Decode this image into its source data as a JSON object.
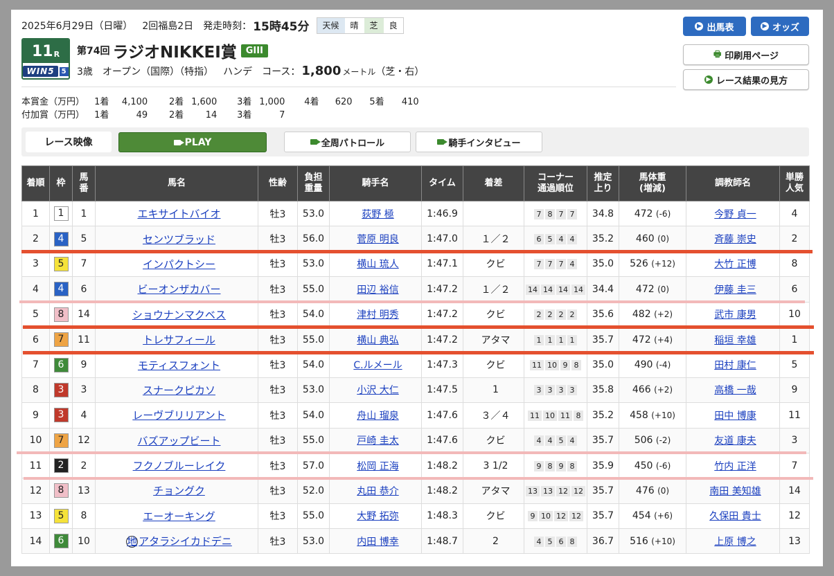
{
  "header": {
    "date": "2025年6月29日（日曜）",
    "meeting": "2回福島2日",
    "start_label": "発走時刻：",
    "start_time": "15時45分",
    "weather_label": "天候",
    "weather": "晴",
    "track_label": "芝",
    "track_cond": "良"
  },
  "race": {
    "number": "11",
    "number_suffix": "R",
    "win5_text": "WIN5",
    "win5_num": "5",
    "edition": "第74回",
    "name": "ラジオNIKKEI賞",
    "grade": "GIII",
    "cond1": "3歳",
    "cond2": "オープン（国際）（特指）",
    "cond3": "ハンデ",
    "course_label": "コース：",
    "distance": "1,800",
    "unit": "メートル",
    "surface": "（芝・右）"
  },
  "prize": {
    "main_label": "本賞金（万円）",
    "add_label": "付加賞（万円）",
    "places": [
      "1着",
      "2着",
      "3着",
      "4着",
      "5着"
    ],
    "main_values": [
      "4,100",
      "1,600",
      "1,000",
      "620",
      "410"
    ],
    "add_values": [
      "49",
      "14",
      "7"
    ]
  },
  "buttons": {
    "entries": "出馬表",
    "odds": "オッズ",
    "print": "印刷用ページ",
    "howto": "レース結果の見方"
  },
  "video": {
    "label": "レース映像",
    "play": "PLAY",
    "patrol": "全周パトロール",
    "interview": "騎手インタビュー"
  },
  "table": {
    "headers": [
      "着順",
      "枠",
      "馬番",
      "馬名",
      "性齢",
      "負担重量",
      "騎手名",
      "タイム",
      "着差",
      "コーナー通過順位",
      "推定上り",
      "馬体重(増減)",
      "調教師名",
      "単勝人気"
    ],
    "rows": [
      {
        "rank": "1",
        "waku": "1",
        "num": "1",
        "name": "エキサイトバイオ",
        "sex": "牡3",
        "wt": "53.0",
        "jockey": "荻野 極",
        "time": "1:46.9",
        "margin": "",
        "corners": [
          "7",
          "8",
          "7",
          "7"
        ],
        "last3f": "34.8",
        "bw": "472",
        "bwd": "(-6)",
        "trainer": "今野 貞一",
        "pop": "4"
      },
      {
        "rank": "2",
        "waku": "4",
        "num": "5",
        "name": "センツブラッド",
        "sex": "牡3",
        "wt": "56.0",
        "jockey": "菅原 明良",
        "time": "1:47.0",
        "margin": "１／２",
        "corners": [
          "6",
          "5",
          "4",
          "4"
        ],
        "last3f": "35.2",
        "bw": "460",
        "bwd": "(0)",
        "trainer": "斉藤 崇史",
        "pop": "2"
      },
      {
        "rank": "3",
        "waku": "5",
        "num": "7",
        "name": "インパクトシー",
        "sex": "牡3",
        "wt": "53.0",
        "jockey": "横山 琉人",
        "time": "1:47.1",
        "margin": "クビ",
        "corners": [
          "7",
          "7",
          "7",
          "4"
        ],
        "last3f": "35.0",
        "bw": "526",
        "bwd": "(+12)",
        "trainer": "大竹 正博",
        "pop": "8"
      },
      {
        "rank": "4",
        "waku": "4",
        "num": "6",
        "name": "ビーオンザカバー",
        "sex": "牡3",
        "wt": "55.0",
        "jockey": "田辺 裕信",
        "time": "1:47.2",
        "margin": "１／２",
        "corners": [
          "14",
          "14",
          "14",
          "14"
        ],
        "last3f": "34.4",
        "bw": "472",
        "bwd": "(0)",
        "trainer": "伊藤 圭三",
        "pop": "6"
      },
      {
        "rank": "5",
        "waku": "8",
        "num": "14",
        "name": "ショウナンマクベス",
        "sex": "牡3",
        "wt": "54.0",
        "jockey": "津村 明秀",
        "time": "1:47.2",
        "margin": "クビ",
        "corners": [
          "2",
          "2",
          "2",
          "2"
        ],
        "last3f": "35.6",
        "bw": "482",
        "bwd": "(+2)",
        "trainer": "武市 康男",
        "pop": "10"
      },
      {
        "rank": "6",
        "waku": "7",
        "num": "11",
        "name": "トレサフィール",
        "sex": "牡3",
        "wt": "55.0",
        "jockey": "横山 典弘",
        "time": "1:47.2",
        "margin": "アタマ",
        "corners": [
          "1",
          "1",
          "1",
          "1"
        ],
        "last3f": "35.7",
        "bw": "472",
        "bwd": "(+4)",
        "trainer": "稲垣 幸雄",
        "pop": "1"
      },
      {
        "rank": "7",
        "waku": "6",
        "num": "9",
        "name": "モティスフォント",
        "sex": "牡3",
        "wt": "54.0",
        "jockey": "C.ルメール",
        "time": "1:47.3",
        "margin": "クビ",
        "corners": [
          "11",
          "10",
          "9",
          "8"
        ],
        "last3f": "35.0",
        "bw": "490",
        "bwd": "(-4)",
        "trainer": "田村 康仁",
        "pop": "5"
      },
      {
        "rank": "8",
        "waku": "3",
        "num": "3",
        "name": "スナークピカソ",
        "sex": "牡3",
        "wt": "53.0",
        "jockey": "小沢 大仁",
        "time": "1:47.5",
        "margin": "1",
        "corners": [
          "3",
          "3",
          "3",
          "3"
        ],
        "last3f": "35.8",
        "bw": "466",
        "bwd": "(+2)",
        "trainer": "高橋 一哉",
        "pop": "9"
      },
      {
        "rank": "9",
        "waku": "3",
        "num": "4",
        "name": "レーヴブリリアント",
        "sex": "牡3",
        "wt": "54.0",
        "jockey": "舟山 瑠泉",
        "time": "1:47.6",
        "margin": "３／４",
        "corners": [
          "11",
          "10",
          "11",
          "8"
        ],
        "last3f": "35.2",
        "bw": "458",
        "bwd": "(+10)",
        "trainer": "田中 博康",
        "pop": "11"
      },
      {
        "rank": "10",
        "waku": "7",
        "num": "12",
        "name": "バズアップビート",
        "sex": "牡3",
        "wt": "55.0",
        "jockey": "戸崎 圭太",
        "time": "1:47.6",
        "margin": "クビ",
        "corners": [
          "4",
          "4",
          "5",
          "4"
        ],
        "last3f": "35.7",
        "bw": "506",
        "bwd": "(-2)",
        "trainer": "友道 康夫",
        "pop": "3"
      },
      {
        "rank": "11",
        "waku": "2",
        "num": "2",
        "name": "フクノブルーレイク",
        "sex": "牡3",
        "wt": "57.0",
        "jockey": "松岡 正海",
        "time": "1:48.2",
        "margin": "3 1/2",
        "corners": [
          "9",
          "8",
          "9",
          "8"
        ],
        "last3f": "35.9",
        "bw": "450",
        "bwd": "(-6)",
        "trainer": "竹内 正洋",
        "pop": "7"
      },
      {
        "rank": "12",
        "waku": "8",
        "num": "13",
        "name": "チョングク",
        "sex": "牡3",
        "wt": "52.0",
        "jockey": "丸田 恭介",
        "time": "1:48.2",
        "margin": "アタマ",
        "corners": [
          "13",
          "13",
          "12",
          "12"
        ],
        "last3f": "35.7",
        "bw": "476",
        "bwd": "(0)",
        "trainer": "南田 美知雄",
        "pop": "14"
      },
      {
        "rank": "13",
        "waku": "5",
        "num": "8",
        "name": "エーオーキング",
        "sex": "牡3",
        "wt": "55.0",
        "jockey": "大野 拓弥",
        "time": "1:48.3",
        "margin": "クビ",
        "corners": [
          "9",
          "10",
          "12",
          "12"
        ],
        "last3f": "35.7",
        "bw": "454",
        "bwd": "(+6)",
        "trainer": "久保田 貴士",
        "pop": "12"
      },
      {
        "rank": "14",
        "waku": "6",
        "num": "10",
        "name": "アタラシイカドデニ",
        "sex": "牡3",
        "wt": "53.0",
        "jockey": "内田 博幸",
        "time": "1:48.7",
        "margin": "2",
        "corners": [
          "4",
          "5",
          "6",
          "8"
        ],
        "last3f": "36.7",
        "bw": "516",
        "bwd": "(+10)",
        "trainer": "上原 博之",
        "pop": "13",
        "mark": "地"
      }
    ]
  },
  "waku_colors": {
    "1": [
      "#ffffff",
      "#222222"
    ],
    "2": [
      "#222222",
      "#ffffff"
    ],
    "3": [
      "#c0392b",
      "#ffffff"
    ],
    "4": [
      "#2a62c4",
      "#ffffff"
    ],
    "5": [
      "#f5e23a",
      "#222222"
    ],
    "6": [
      "#3f8a3a",
      "#ffffff"
    ],
    "7": [
      "#eea445",
      "#222222"
    ],
    "8": [
      "#f1bfc8",
      "#222222"
    ]
  },
  "colors": {
    "accent_blue": "#2d6bc0",
    "accent_green": "#3c8a2e",
    "marker_red": "#e4502f",
    "marker_pink": "#f2b9b9"
  }
}
